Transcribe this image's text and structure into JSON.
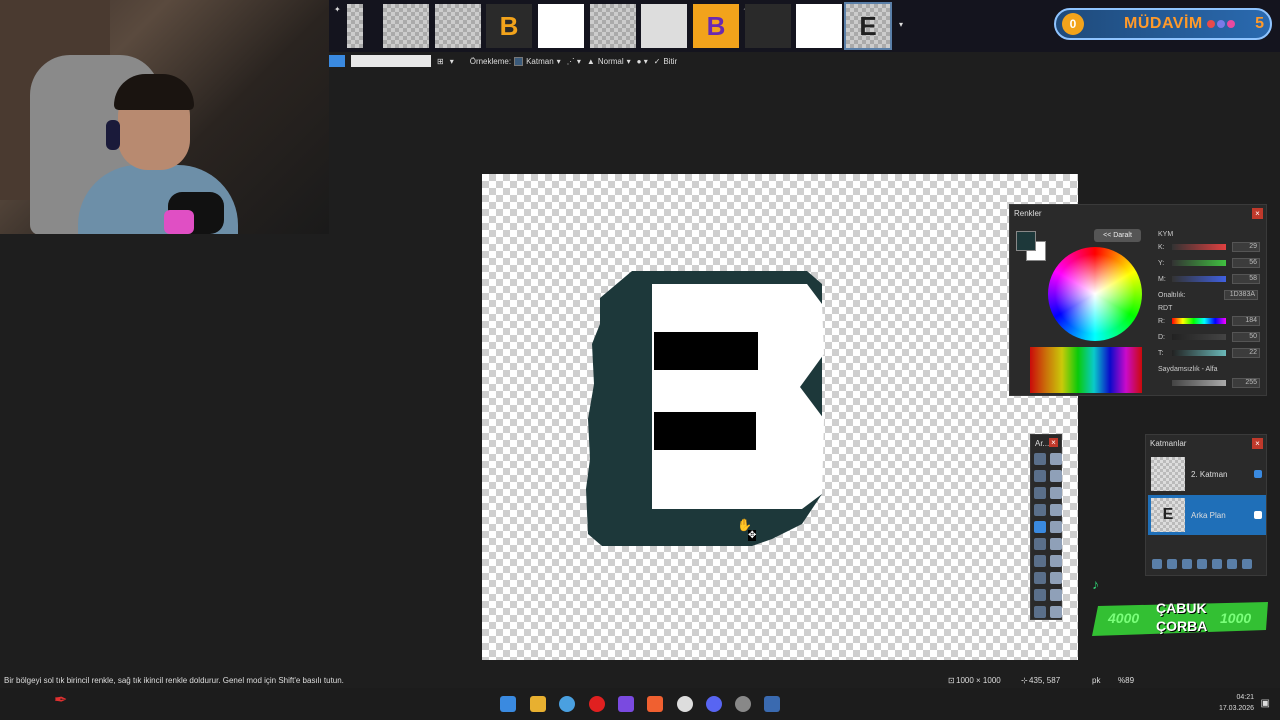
{
  "toolbar": {
    "sampling_label": "Örnekleme:",
    "sampling_value": "Katman",
    "blend_value": "Normal",
    "finish_label": "Bitir"
  },
  "badge": {
    "coin_label": "0",
    "name": "MÜDAVİM",
    "count": "5"
  },
  "thumbnails": [
    {
      "label": "",
      "selected": false
    },
    {
      "label": "",
      "selected": false
    },
    {
      "label": "",
      "selected": false
    },
    {
      "label": "B",
      "selected": false
    },
    {
      "label": "",
      "selected": false
    },
    {
      "label": "",
      "selected": false
    },
    {
      "label": "",
      "selected": false
    },
    {
      "label": "B",
      "selected": false
    },
    {
      "label": "",
      "selected": false
    },
    {
      "label": "",
      "selected": false
    },
    {
      "label": "E",
      "selected": true
    }
  ],
  "colors_panel": {
    "title": "Renkler",
    "collapse_label": "<< Daralt",
    "primary_color": "#1d383a",
    "secondary_color": "#ffffff",
    "cmy_header": "KYM",
    "k_label": "K:",
    "k_value": "29",
    "y_label": "Y:",
    "y_value": "56",
    "m_label": "M:",
    "m_value": "58",
    "hex_label": "Onaltılık:",
    "hex_value": "1D383A",
    "rgb_header": "RDT",
    "r_label": "R:",
    "r_value": "184",
    "d_label": "D:",
    "d_value": "50",
    "t_label": "T:",
    "t_value": "22",
    "alpha_label": "Saydamsızlık - Alfa",
    "alpha_value": "255"
  },
  "tools_panel": {
    "title": "Ar..."
  },
  "layers_panel": {
    "title": "Katmanlar",
    "layers": [
      {
        "name": "2. Katman",
        "thumb": "",
        "selected": false
      },
      {
        "name": "Arka Plan",
        "thumb": "E",
        "selected": true
      }
    ]
  },
  "overlay": {
    "left_number": "4000",
    "title_line1": "ÇABUK",
    "title_line2": "ÇORBA",
    "right_number": "1000"
  },
  "status": {
    "hint": "Bir bölgeyi sol tık birincil renkle, sağ tık ikincil renkle doldurur. Genel mod için Shift'e basılı tutun.",
    "image_size": "1000 × 1000",
    "cursor_pos": "435, 587",
    "unit": "pk",
    "zoom": "%89"
  },
  "taskbar": {
    "time": "04:21",
    "date": "17.03.2026"
  },
  "canvas_colors": {
    "letter_fill": "#ffffff",
    "letter_shadow": "#1d383a",
    "letter_holes": "#000000"
  }
}
